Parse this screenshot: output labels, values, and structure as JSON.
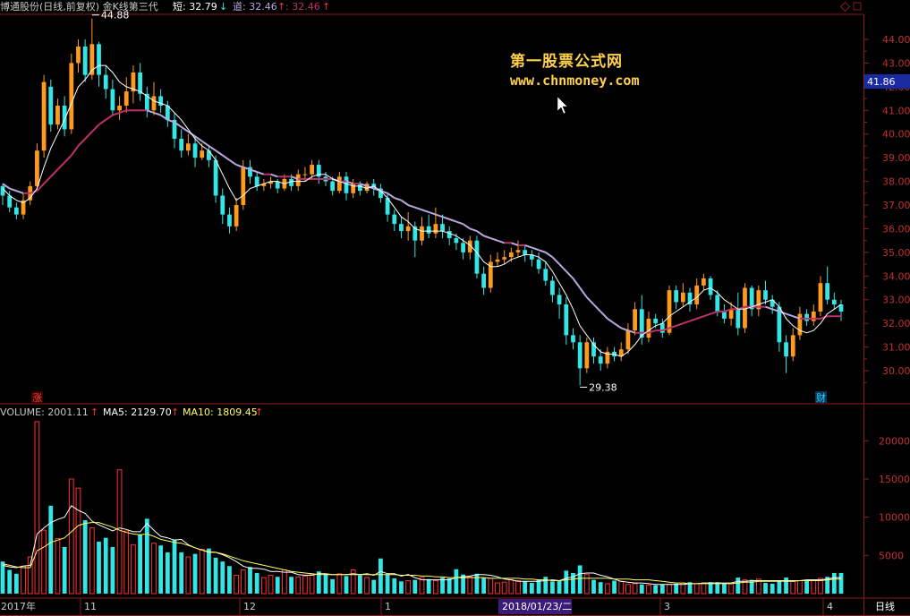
{
  "header": {
    "title": "博通股份(日线,前复权) 金K线第三代",
    "short_label": "短: 32.79",
    "short_arrow": "↓",
    "dao_label": "道: 32.46",
    "dao_arrow": "↑",
    "extra_value": ": 32.46",
    "extra_arrow": "↑"
  },
  "watermark": {
    "line1": "第一股票公式网",
    "line2": "www.chnmoney.com"
  },
  "price_axis": {
    "ticks": [
      "44.00",
      "43.00",
      "42.00",
      "41.00",
      "40.00",
      "39.00",
      "38.00",
      "37.00",
      "36.00",
      "35.00",
      "34.00",
      "33.00",
      "32.00",
      "31.00",
      "30.00"
    ],
    "current_price": "41.86"
  },
  "markers": {
    "high_label": "44.88",
    "low_label": "29.38",
    "zhang_badge": "涨",
    "cai_badge": "财"
  },
  "volume_header": {
    "volume": "VOLUME: 2001.11",
    "volume_arrow": "↑",
    "ma5": "MA5: 2129.70",
    "ma5_arrow": "↑",
    "ma10": "MA10: 1809.45",
    "ma10_arrow": "↑"
  },
  "volume_axis": {
    "ticks": [
      "20000",
      "15000",
      "10000",
      "5000"
    ]
  },
  "date_axis": {
    "labels": [
      "2017年",
      "11",
      "12",
      "1",
      "3",
      "4"
    ],
    "cursor_date": "2018/01/23/二",
    "period": "日线"
  },
  "colors": {
    "up": "#ff9a1e",
    "down": "#33e6e6",
    "ma_short": "#ffffff",
    "ma_long_up": "#c0306a",
    "ma_long_down": "#b8a8e0",
    "grid": "#8b1a1a",
    "vol_up_outline": "#ff3030",
    "ma5_vol": "#ffffff",
    "ma10_vol": "#ffff66"
  },
  "chart_data": {
    "type": "candlestick",
    "price_range": [
      29.0,
      44.9
    ],
    "candles": [
      [
        37.8,
        37.4,
        37.9,
        37.0
      ],
      [
        37.4,
        36.9,
        37.6,
        36.7
      ],
      [
        36.9,
        36.6,
        37.1,
        36.4
      ],
      [
        36.6,
        37.2,
        37.5,
        36.4
      ],
      [
        37.2,
        37.8,
        38.0,
        37.0
      ],
      [
        37.8,
        39.3,
        39.6,
        37.6
      ],
      [
        39.3,
        42.2,
        42.5,
        39.0
      ],
      [
        42.0,
        40.4,
        42.3,
        40.1
      ],
      [
        40.4,
        41.2,
        41.5,
        40.2
      ],
      [
        41.2,
        40.2,
        41.6,
        39.9
      ],
      [
        40.2,
        43.0,
        43.4,
        40.0
      ],
      [
        43.0,
        43.7,
        44.0,
        42.6
      ],
      [
        43.7,
        42.5,
        44.0,
        42.2
      ],
      [
        42.5,
        43.8,
        44.88,
        42.3
      ],
      [
        43.8,
        42.5,
        43.9,
        42.0
      ],
      [
        42.5,
        41.9,
        42.9,
        41.5
      ],
      [
        41.9,
        41.0,
        42.3,
        40.8
      ],
      [
        41.0,
        41.2,
        41.6,
        40.6
      ],
      [
        41.2,
        41.8,
        42.4,
        40.9
      ],
      [
        41.8,
        42.6,
        42.9,
        41.3
      ],
      [
        42.6,
        41.7,
        43.0,
        41.4
      ],
      [
        41.7,
        41.0,
        42.0,
        40.7
      ],
      [
        41.0,
        41.6,
        42.2,
        40.8
      ],
      [
        41.6,
        41.2,
        41.9,
        40.9
      ],
      [
        41.2,
        40.6,
        41.4,
        40.3
      ],
      [
        40.6,
        39.8,
        40.9,
        39.4
      ],
      [
        39.8,
        39.3,
        40.2,
        39.0
      ],
      [
        39.3,
        39.6,
        40.0,
        39.1
      ],
      [
        39.6,
        39.0,
        39.9,
        38.6
      ],
      [
        39.0,
        39.3,
        39.6,
        38.9
      ],
      [
        39.3,
        38.9,
        39.5,
        38.6
      ],
      [
        38.9,
        37.4,
        39.1,
        37.1
      ],
      [
        37.4,
        36.6,
        37.7,
        36.2
      ],
      [
        36.6,
        36.1,
        36.9,
        35.8
      ],
      [
        36.1,
        37.0,
        37.3,
        35.9
      ],
      [
        37.0,
        38.6,
        38.9,
        36.8
      ],
      [
        38.6,
        38.2,
        38.9,
        37.9
      ],
      [
        38.2,
        37.8,
        38.4,
        37.6
      ],
      [
        37.8,
        37.9,
        38.1,
        37.6
      ],
      [
        37.9,
        38.0,
        38.2,
        37.7
      ],
      [
        38.0,
        37.7,
        38.1,
        37.5
      ],
      [
        37.7,
        38.1,
        38.3,
        37.6
      ],
      [
        38.1,
        37.8,
        38.3,
        37.6
      ],
      [
        37.8,
        38.3,
        38.5,
        37.6
      ],
      [
        38.3,
        38.3,
        38.6,
        38.0
      ],
      [
        38.3,
        38.7,
        38.9,
        38.1
      ],
      [
        38.7,
        38.2,
        38.9,
        37.9
      ],
      [
        38.2,
        38.0,
        38.4,
        37.8
      ],
      [
        38.0,
        37.6,
        38.2,
        37.4
      ],
      [
        37.6,
        38.2,
        38.4,
        37.5
      ],
      [
        38.2,
        37.5,
        38.4,
        37.2
      ],
      [
        37.5,
        37.9,
        38.1,
        37.3
      ],
      [
        37.9,
        37.6,
        38.0,
        37.4
      ],
      [
        37.6,
        37.9,
        38.0,
        37.5
      ],
      [
        37.9,
        37.7,
        38.1,
        37.4
      ],
      [
        37.7,
        37.3,
        37.9,
        37.1
      ],
      [
        37.3,
        36.6,
        37.5,
        36.3
      ],
      [
        36.6,
        36.2,
        36.8,
        35.9
      ],
      [
        36.2,
        35.9,
        36.5,
        35.6
      ],
      [
        35.9,
        36.1,
        36.7,
        35.5
      ],
      [
        36.1,
        35.5,
        36.3,
        34.8
      ],
      [
        35.5,
        36.1,
        36.5,
        35.3
      ],
      [
        36.1,
        35.8,
        36.6,
        35.6
      ],
      [
        35.8,
        36.2,
        36.9,
        35.6
      ],
      [
        36.2,
        35.9,
        36.6,
        35.6
      ],
      [
        35.9,
        35.6,
        36.1,
        35.3
      ],
      [
        35.6,
        35.4,
        35.8,
        35.1
      ],
      [
        35.4,
        35.0,
        35.6,
        34.7
      ],
      [
        35.0,
        35.5,
        35.7,
        34.7
      ],
      [
        35.5,
        34.1,
        35.7,
        33.9
      ],
      [
        34.1,
        33.5,
        34.4,
        33.2
      ],
      [
        33.5,
        34.6,
        34.9,
        33.3
      ],
      [
        34.6,
        34.7,
        35.0,
        34.4
      ],
      [
        34.7,
        34.8,
        35.1,
        34.5
      ],
      [
        34.8,
        35.0,
        35.2,
        34.6
      ],
      [
        35.0,
        35.1,
        35.5,
        34.8
      ],
      [
        35.1,
        34.9,
        35.3,
        34.6
      ],
      [
        34.9,
        34.7,
        35.1,
        34.4
      ],
      [
        34.7,
        34.3,
        35.0,
        34.1
      ],
      [
        34.3,
        33.8,
        34.6,
        33.6
      ],
      [
        33.8,
        33.2,
        34.0,
        32.9
      ],
      [
        33.2,
        32.8,
        33.5,
        32.2
      ],
      [
        32.8,
        31.5,
        33.1,
        31.1
      ],
      [
        31.5,
        31.2,
        31.8,
        30.9
      ],
      [
        31.2,
        30.1,
        31.5,
        29.38
      ],
      [
        30.1,
        31.2,
        31.4,
        29.9
      ],
      [
        31.2,
        30.6,
        31.4,
        30.3
      ],
      [
        30.6,
        30.3,
        30.9,
        30.0
      ],
      [
        30.3,
        30.8,
        31.0,
        30.1
      ],
      [
        30.8,
        30.6,
        31.0,
        30.4
      ],
      [
        30.6,
        30.9,
        31.2,
        30.4
      ],
      [
        30.9,
        31.7,
        32.0,
        30.7
      ],
      [
        31.7,
        32.6,
        32.9,
        31.5
      ],
      [
        32.6,
        31.4,
        33.2,
        31.1
      ],
      [
        31.4,
        32.2,
        32.5,
        31.2
      ],
      [
        32.2,
        32.0,
        32.4,
        31.8
      ],
      [
        32.0,
        31.6,
        32.2,
        31.4
      ],
      [
        31.6,
        33.4,
        33.6,
        31.5
      ],
      [
        33.4,
        32.9,
        33.6,
        32.6
      ],
      [
        32.9,
        33.3,
        33.7,
        32.7
      ],
      [
        33.3,
        32.8,
        33.5,
        32.5
      ],
      [
        32.8,
        33.6,
        33.9,
        32.6
      ],
      [
        33.6,
        33.9,
        34.1,
        33.4
      ],
      [
        33.9,
        33.2,
        34.0,
        33.0
      ],
      [
        33.2,
        32.5,
        33.4,
        32.3
      ],
      [
        32.5,
        32.2,
        32.8,
        32.0
      ],
      [
        32.2,
        32.6,
        32.9,
        31.9
      ],
      [
        32.6,
        31.8,
        33.3,
        31.5
      ],
      [
        31.8,
        33.5,
        33.7,
        31.6
      ],
      [
        33.5,
        32.6,
        33.6,
        32.3
      ],
      [
        32.6,
        33.4,
        33.6,
        32.3
      ],
      [
        33.4,
        33.0,
        33.8,
        32.8
      ],
      [
        33.0,
        32.7,
        33.2,
        32.4
      ],
      [
        32.7,
        31.2,
        32.9,
        30.8
      ],
      [
        31.2,
        30.6,
        31.5,
        29.9
      ],
      [
        30.6,
        31.5,
        31.8,
        30.4
      ],
      [
        31.5,
        32.4,
        32.7,
        31.3
      ],
      [
        32.4,
        32.1,
        32.6,
        31.9
      ],
      [
        32.1,
        32.5,
        32.8,
        31.9
      ],
      [
        32.5,
        33.7,
        34.0,
        32.3
      ],
      [
        33.7,
        33.0,
        34.4,
        32.8
      ],
      [
        33.0,
        32.8,
        33.3,
        32.6
      ],
      [
        32.8,
        32.5,
        33.0,
        32.1
      ]
    ],
    "ma_short": [
      37.7,
      37.4,
      37.2,
      37.1,
      37.3,
      37.7,
      38.6,
      39.4,
      40.0,
      40.6,
      41.3,
      42.0,
      42.3,
      42.7,
      42.9,
      42.9,
      42.6,
      42.2,
      42.0,
      41.9,
      41.8,
      41.6,
      41.4,
      41.3,
      41.2,
      40.9,
      40.6,
      40.2,
      39.8,
      39.5,
      39.3,
      38.9,
      38.3,
      37.7,
      37.2,
      37.4,
      37.7,
      37.8,
      37.9,
      38.0,
      38.0,
      37.9,
      38.0,
      38.0,
      38.0,
      38.2,
      38.3,
      38.3,
      38.1,
      38.0,
      37.9,
      37.8,
      37.8,
      37.7,
      37.8,
      37.6,
      37.3,
      36.9,
      36.5,
      36.3,
      36.0,
      35.9,
      35.9,
      35.9,
      35.9,
      35.8,
      35.7,
      35.5,
      35.3,
      35.0,
      34.6,
      34.4,
      34.4,
      34.5,
      34.7,
      34.8,
      34.9,
      34.9,
      34.8,
      34.6,
      34.2,
      33.7,
      33.2,
      32.6,
      31.9,
      31.5,
      31.1,
      30.8,
      30.7,
      30.7,
      30.6,
      30.8,
      31.1,
      31.5,
      31.7,
      31.9,
      32.0,
      32.3,
      32.5,
      32.7,
      32.9,
      33.1,
      33.4,
      33.5,
      33.3,
      33.0,
      32.8,
      32.6,
      32.6,
      32.7,
      32.8,
      32.9,
      33.0,
      32.7,
      32.2,
      31.9,
      31.7,
      31.6,
      31.7,
      32.0,
      32.4,
      32.6,
      32.8
    ],
    "ma_long": [
      37.9,
      37.7,
      37.6,
      37.5,
      37.5,
      37.6,
      37.9,
      38.2,
      38.5,
      38.8,
      39.1,
      39.5,
      39.8,
      40.1,
      40.4,
      40.6,
      40.8,
      40.9,
      41.0,
      41.0,
      41.0,
      41.0,
      40.9,
      40.8,
      40.6,
      40.5,
      40.3,
      40.1,
      39.9,
      39.7,
      39.5,
      39.3,
      39.1,
      38.9,
      38.7,
      38.6,
      38.5,
      38.4,
      38.3,
      38.3,
      38.2,
      38.2,
      38.2,
      38.1,
      38.1,
      38.1,
      38.1,
      38.1,
      38.1,
      38.0,
      38.0,
      37.9,
      37.9,
      37.8,
      37.7,
      37.6,
      37.5,
      37.3,
      37.2,
      37.0,
      36.9,
      36.8,
      36.7,
      36.6,
      36.5,
      36.4,
      36.3,
      36.2,
      36.0,
      35.9,
      35.7,
      35.6,
      35.5,
      35.4,
      35.4,
      35.3,
      35.3,
      35.2,
      35.1,
      35.0,
      34.8,
      34.5,
      34.2,
      33.9,
      33.5,
      33.1,
      32.8,
      32.5,
      32.2,
      32.0,
      31.8,
      31.7,
      31.6,
      31.6,
      31.6,
      31.7,
      31.7,
      31.8,
      31.9,
      32.0,
      32.1,
      32.2,
      32.3,
      32.4,
      32.5,
      32.5,
      32.6,
      32.6,
      32.7,
      32.7,
      32.7,
      32.7,
      32.6,
      32.5,
      32.4,
      32.3,
      32.2,
      32.2,
      32.2,
      32.2,
      32.3,
      32.3,
      32.3
    ],
    "volume": [
      4200,
      3100,
      2600,
      3600,
      4800,
      22500,
      8300,
      11500,
      7200,
      6100,
      15000,
      13800,
      9600,
      8600,
      6800,
      7300,
      6100,
      16200,
      8200,
      6400,
      7700,
      9800,
      6600,
      6300,
      5400,
      7100,
      5400,
      4800,
      5200,
      5800,
      5900,
      4700,
      4200,
      3600,
      2400,
      3100,
      3500,
      2700,
      2100,
      2400,
      2200,
      3100,
      2200,
      2200,
      2300,
      2500,
      2900,
      2600,
      1900,
      2600,
      2300,
      3100,
      2400,
      2100,
      1800,
      4600,
      2500,
      2000,
      1600,
      1700,
      1800,
      2100,
      1900,
      1700,
      2100,
      2000,
      3200,
      2500,
      2200,
      2600,
      2100,
      2000,
      1400,
      1500,
      1800,
      1700,
      1600,
      1400,
      1800,
      2200,
      1600,
      1700,
      3000,
      2700,
      3700,
      2500,
      1800,
      1500,
      1300,
      1700,
      1600,
      1200,
      1300,
      1200,
      1100,
      1100,
      1200,
      1200,
      1300,
      1400,
      1500,
      1300,
      1400,
      1500,
      1500,
      1400,
      1300,
      2100,
      1800,
      1800,
      1900,
      1400,
      1300,
      1700,
      2100,
      1600,
      1700,
      1800,
      1800,
      2000,
      2200,
      2700,
      2700
    ],
    "vol_ma5": [
      3700,
      3500,
      3400,
      3600,
      3700,
      7800,
      8600,
      9300,
      9700,
      10000,
      11500,
      10900,
      10500,
      9500,
      9000,
      8600,
      8200,
      8600,
      8400,
      8100,
      8100,
      9200,
      8300,
      7500,
      7300,
      7000,
      7100,
      6400,
      6000,
      5700,
      5400,
      5400,
      5100,
      4700,
      4200,
      3600,
      3300,
      3300,
      3200,
      2900,
      2900,
      2800,
      2800,
      2500,
      2400,
      2400,
      2600,
      2600,
      2500,
      2500,
      2500,
      2600,
      2500,
      2600,
      2400,
      2900,
      2600,
      2600,
      2300,
      2500,
      2100,
      1800,
      1800,
      1800,
      1800,
      1800,
      2100,
      2200,
      2300,
      2500,
      2500,
      2400,
      2200,
      1900,
      1800,
      1600,
      1600,
      1600,
      1600,
      1700,
      1800,
      1700,
      2000,
      2200,
      2600,
      2700,
      2700,
      2400,
      2200,
      1900,
      1600,
      1500,
      1400,
      1400,
      1300,
      1200,
      1200,
      1200,
      1200,
      1200,
      1300,
      1300,
      1400,
      1400,
      1400,
      1400,
      1400,
      1600,
      1600,
      1700,
      1700,
      1700,
      1700,
      1700,
      1700,
      1700,
      1700,
      1800,
      1800,
      1800,
      1900,
      2100,
      2100
    ],
    "vol_ma10": [
      3900,
      3700,
      3500,
      3400,
      3400,
      5600,
      6100,
      6700,
      7000,
      7300,
      8100,
      8900,
      9200,
      9300,
      9300,
      9000,
      8700,
      8300,
      8000,
      7800,
      7700,
      7800,
      7500,
      7100,
      6900,
      6700,
      6600,
      6300,
      6000,
      5700,
      5500,
      5400,
      5200,
      4900,
      4600,
      4300,
      4100,
      3900,
      3700,
      3500,
      3300,
      3100,
      2900,
      2800,
      2700,
      2600,
      2500,
      2500,
      2500,
      2500,
      2500,
      2500,
      2500,
      2500,
      2500,
      2500,
      2500,
      2500,
      2400,
      2400,
      2400,
      2300,
      2300,
      2200,
      2200,
      2100,
      2100,
      2100,
      2100,
      2100,
      2100,
      2000,
      2000,
      2000,
      2000,
      2000,
      1900,
      1900,
      1800,
      1800,
      1700,
      1700,
      1800,
      1900,
      2000,
      2000,
      2000,
      2000,
      2000,
      1900,
      1900,
      1900,
      1800,
      1800,
      1800,
      1700,
      1600,
      1500,
      1400,
      1400,
      1300,
      1300,
      1300,
      1300,
      1300,
      1300,
      1300,
      1400,
      1500,
      1500,
      1600,
      1600,
      1600,
      1600,
      1600,
      1600,
      1700,
      1700,
      1700,
      1700,
      1800,
      1900,
      1900
    ]
  }
}
